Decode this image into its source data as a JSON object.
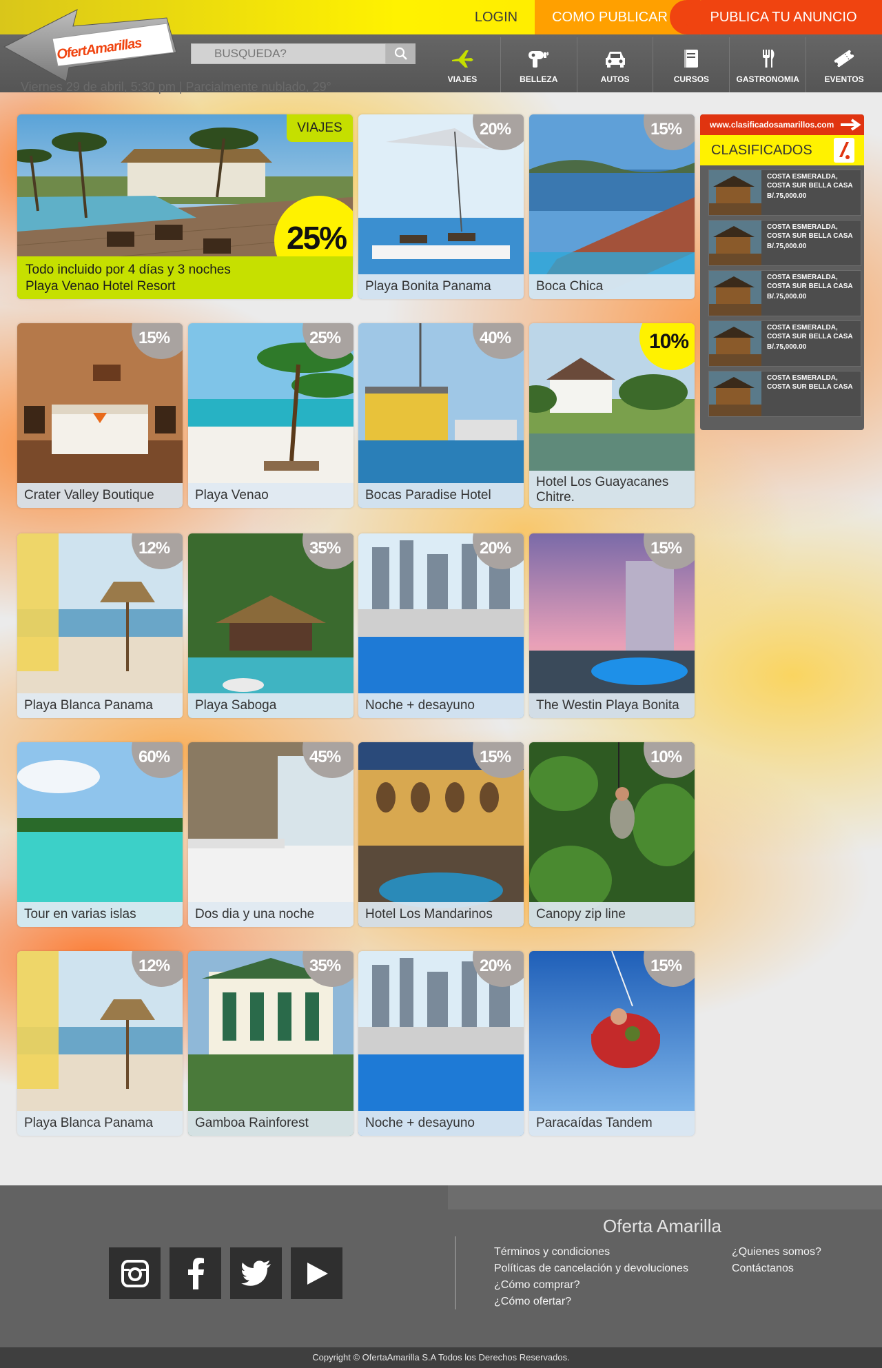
{
  "header": {
    "nav": {
      "login": "LOGIN",
      "como_publicar": "COMO PUBLICAR",
      "publica": "PUBLICA TU ANUNCIO"
    },
    "logo_text": "OfertAmarillas",
    "search_placeholder": "BUSQUEDA?",
    "date_line": "Viernes 29 de abril,  5:30 pm | Parcialmente nublado, 29°",
    "categories": [
      {
        "label": "VIAJES",
        "icon": "airplane-icon",
        "color": "#c5df00"
      },
      {
        "label": "BELLEZA",
        "icon": "hair-dryer-icon",
        "color": "#ffffff"
      },
      {
        "label": "AUTOS",
        "icon": "car-icon",
        "color": "#ffffff"
      },
      {
        "label": "CURSOS",
        "icon": "book-icon",
        "color": "#ffffff"
      },
      {
        "label": "GASTRONOMIA",
        "icon": "fork-knife-icon",
        "color": "#ffffff"
      },
      {
        "label": "EVENTOS",
        "icon": "ticket-icon",
        "color": "#ffffff"
      }
    ]
  },
  "featured": {
    "tag": "VIAJES",
    "discount": "25%",
    "line1": "Todo incluido por 4 días y 3 noches",
    "line2": "Playa Venao Hotel Resort"
  },
  "offers": [
    {
      "title": "Playa Bonita Panama",
      "discount": "20%"
    },
    {
      "title": "Boca Chica",
      "discount": "15%"
    },
    {
      "title": "Crater Valley Boutique",
      "discount": "15%"
    },
    {
      "title": "Playa Venao",
      "discount": "25%"
    },
    {
      "title": "Bocas Paradise Hotel",
      "discount": "40%"
    },
    {
      "title": "Hotel Los Guayacanes Chitre.",
      "discount": "10%"
    },
    {
      "title": "Playa Blanca Panama",
      "discount": "12%"
    },
    {
      "title": "Playa Saboga",
      "discount": "35%"
    },
    {
      "title": "Noche + desayuno",
      "discount": "20%"
    },
    {
      "title": "The Westin Playa Bonita",
      "discount": "15%"
    },
    {
      "title": "Tour en varias islas",
      "discount": "60%"
    },
    {
      "title": "Dos dia y una noche",
      "discount": "45%"
    },
    {
      "title": "Hotel Los Mandarinos",
      "discount": "15%"
    },
    {
      "title": "Canopy zip line",
      "discount": "10%"
    },
    {
      "title": "Playa Blanca Panama",
      "discount": "12%"
    },
    {
      "title": "Gamboa Rainforest",
      "discount": "35%"
    },
    {
      "title": "Noche + desayuno",
      "discount": "20%"
    },
    {
      "title": "Paracaídas Tandem",
      "discount": "15%"
    }
  ],
  "clasificados": {
    "url": "www.clasificadosamarillos.com",
    "title": "CLASIFICADOS",
    "items": [
      {
        "text": "COSTA ESMERALDA, COSTA SUR BELLA CASA",
        "price": "B/.75,000.00"
      },
      {
        "text": "COSTA ESMERALDA, COSTA SUR BELLA CASA",
        "price": "B/.75,000.00"
      },
      {
        "text": "COSTA ESMERALDA, COSTA SUR BELLA CASA",
        "price": "B/.75,000.00"
      },
      {
        "text": "COSTA ESMERALDA, COSTA SUR BELLA CASA",
        "price": "B/.75,000.00"
      },
      {
        "text": "COSTA ESMERALDA, COSTA SUR BELLA CASA",
        "price": ""
      }
    ]
  },
  "footer": {
    "brand": "Oferta Amarilla",
    "links_col1": [
      "Términos y condiciones",
      "Políticas de cancelación y devoluciones",
      "¿Cómo comprar?",
      "¿Cómo ofertar?"
    ],
    "links_col2": [
      "¿Quienes somos?",
      "Contáctanos"
    ],
    "social": [
      "instagram-icon",
      "facebook-icon",
      "twitter-icon",
      "youtube-icon"
    ],
    "copyright": "Copyright © OfertaAmarilla S.A Todos los Derechos Reservados."
  },
  "colors": {
    "yellow": "#fff200",
    "orange": "#ffa000",
    "red": "#f04410",
    "lime": "#c5df00",
    "dark": "#555555",
    "badge_gray": "#a9a3a0"
  }
}
